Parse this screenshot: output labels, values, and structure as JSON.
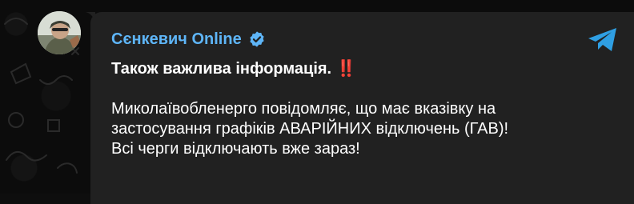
{
  "channel": {
    "name": "Сєнкевич Online",
    "verified_icon": "verified-badge-icon",
    "accent_color": "#5eb5f7"
  },
  "message": {
    "headline": "Також важлива інформація.",
    "headline_emoji": "‼️",
    "body_lines": [
      "Миколаївобленерго повідомляє, що має вказівку на",
      "застосування графіків АВАРІЙНИХ відключень (ГАВ)!",
      "Всі черги відключають вже зараз!"
    ]
  },
  "actions": {
    "share_icon": "telegram-share-icon"
  },
  "colors": {
    "bubble": "#212121",
    "background": "#0c0c0c",
    "text": "#ffffff",
    "share": "#2f9fe3"
  }
}
